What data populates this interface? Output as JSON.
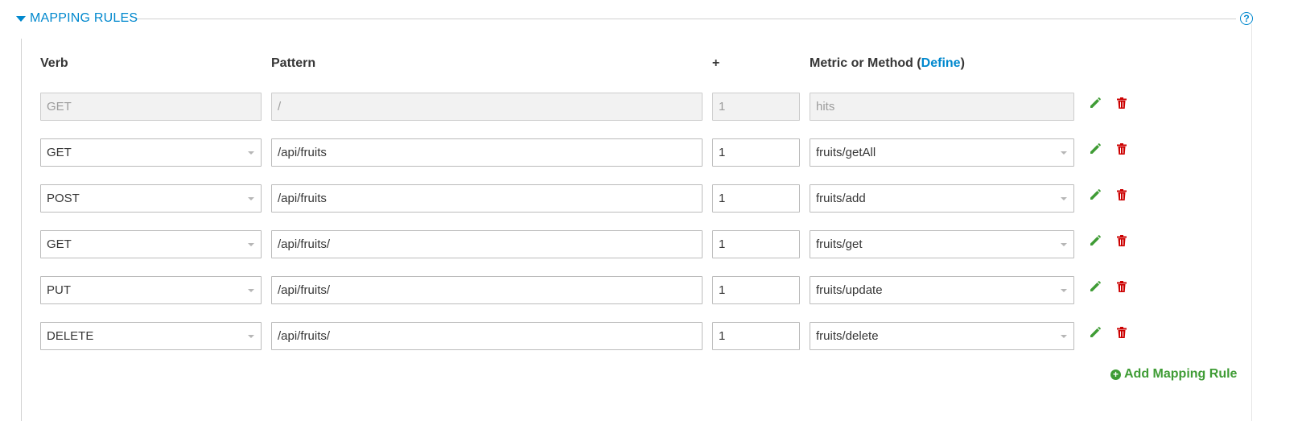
{
  "section": {
    "title": "MAPPING RULES",
    "help_symbol": "?"
  },
  "headers": {
    "verb": "Verb",
    "pattern": "Pattern",
    "delta": "+",
    "metric_prefix": "Metric or Method (",
    "metric_link": "Define",
    "metric_suffix": ")"
  },
  "default_rule": {
    "verb_placeholder": "GET",
    "pattern_placeholder": "/",
    "delta_placeholder": "1",
    "metric_placeholder": "hits"
  },
  "rules": [
    {
      "verb": "GET",
      "pattern": "/api/fruits",
      "delta": "1",
      "metric": "fruits/getAll"
    },
    {
      "verb": "POST",
      "pattern": "/api/fruits",
      "delta": "1",
      "metric": "fruits/add"
    },
    {
      "verb": "GET",
      "pattern": "/api/fruits/",
      "delta": "1",
      "metric": "fruits/get"
    },
    {
      "verb": "PUT",
      "pattern": "/api/fruits/",
      "delta": "1",
      "metric": "fruits/update"
    },
    {
      "verb": "DELETE",
      "pattern": "/api/fruits/",
      "delta": "1",
      "metric": "fruits/delete"
    }
  ],
  "add_rule_label": "Add Mapping Rule",
  "icons": {
    "edit": "pencil-icon",
    "delete": "trash-icon",
    "add": "plus-circle-icon",
    "help": "question-circle-icon",
    "toggle": "caret-down-icon"
  },
  "colors": {
    "accent": "#0088ce",
    "edit": "#3f9c35",
    "delete": "#cc0000",
    "add": "#3f9c35"
  }
}
